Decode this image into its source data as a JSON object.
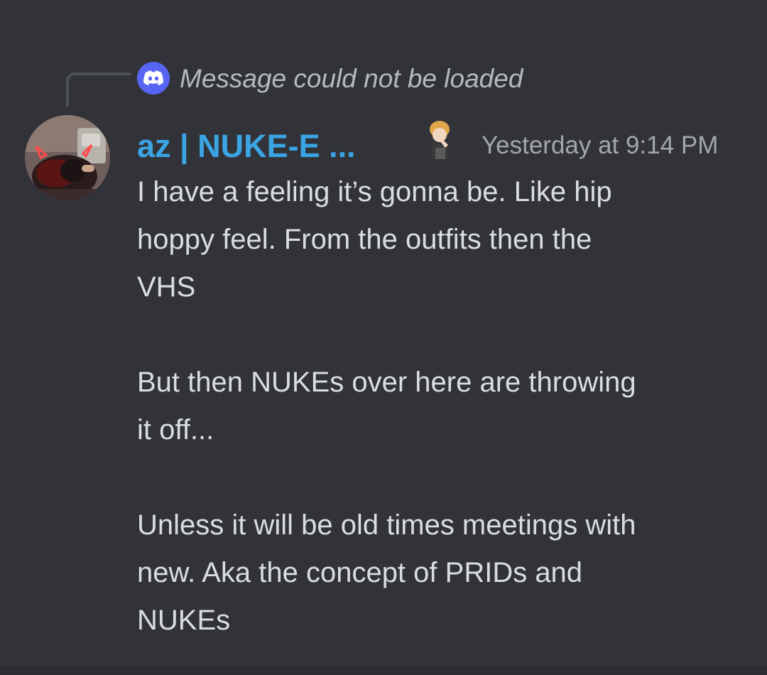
{
  "reply": {
    "icon": "discord-logo-icon",
    "text": "Message could not be loaded"
  },
  "author": {
    "avatar": "user-avatar-devil-horns",
    "name": "az | NUKE-E ...",
    "name_color": "#3ba4e4",
    "role_icon": "character-sticker-icon",
    "timestamp": "Yesterday at 9:14 PM"
  },
  "message": {
    "paragraphs": [
      "I have a feeling it’s gonna be. Like hip\nhoppy feel. From the outfits then the\nVHS",
      "But then NUKEs over here are throwing\nit off...",
      "Unless it will be old times meetings with\nnew. Aka the concept of PRIDs and\nNUKEs"
    ]
  },
  "colors": {
    "background": "#313338",
    "text": "#dbdee1",
    "muted": "#b5bac1",
    "accent": "#5865f2"
  }
}
